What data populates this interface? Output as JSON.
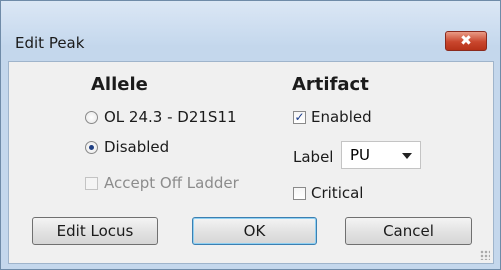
{
  "window": {
    "title": "Edit Peak",
    "close_glyph": "✖"
  },
  "allele": {
    "heading": "Allele",
    "option_locus": "OL 24.3 - D21S11",
    "option_disabled": "Disabled",
    "accept_off_ladder": "Accept Off Ladder",
    "selected": "Disabled"
  },
  "artifact": {
    "heading": "Artifact",
    "enabled_label": "Enabled",
    "enabled_checked": true,
    "label_caption": "Label",
    "label_value": "PU",
    "critical_label": "Critical",
    "critical_checked": false
  },
  "buttons": {
    "edit_locus": "Edit Locus",
    "ok": "OK",
    "cancel": "Cancel"
  },
  "colors": {
    "frame": "#c4d7ec",
    "close_button": "#c9462d",
    "client_bg": "#f0f0f0"
  }
}
